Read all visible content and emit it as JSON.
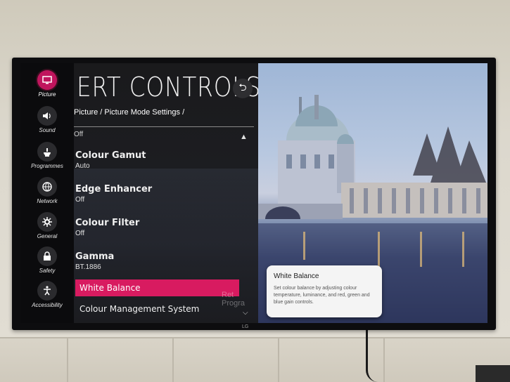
{
  "menu": {
    "title": "ERT CONTROLS",
    "breadcrumb": "Picture / Picture Mode Settings /",
    "partial_value": "Off",
    "items": [
      {
        "label": "Colour Gamut",
        "value": "Auto"
      },
      {
        "label": "Edge Enhancer",
        "value": "Off"
      },
      {
        "label": "Colour Filter",
        "value": "Off"
      },
      {
        "label": "Gamma",
        "value": "BT.1886"
      }
    ],
    "selected": "White Balance",
    "next": "Colour Management System",
    "ghost_text": "Ret Progra"
  },
  "rail": [
    {
      "label": "Picture",
      "icon": "picture-icon",
      "active": true
    },
    {
      "label": "Sound",
      "icon": "speaker-icon"
    },
    {
      "label": "Programmes",
      "icon": "satellite-icon"
    },
    {
      "label": "Network",
      "icon": "globe-icon"
    },
    {
      "label": "General",
      "icon": "gear-icon"
    },
    {
      "label": "Safety",
      "icon": "lock-icon"
    },
    {
      "label": "Accessibility",
      "icon": "accessibility-icon"
    }
  ],
  "tooltip": {
    "title": "White Balance",
    "body": "Set colour balance by adjusting colour temperature, luminance, and red, green and blue gain controls."
  },
  "tv_brand": "LG",
  "colors": {
    "accent": "#d81b60",
    "panel": "#1a1a1c"
  }
}
